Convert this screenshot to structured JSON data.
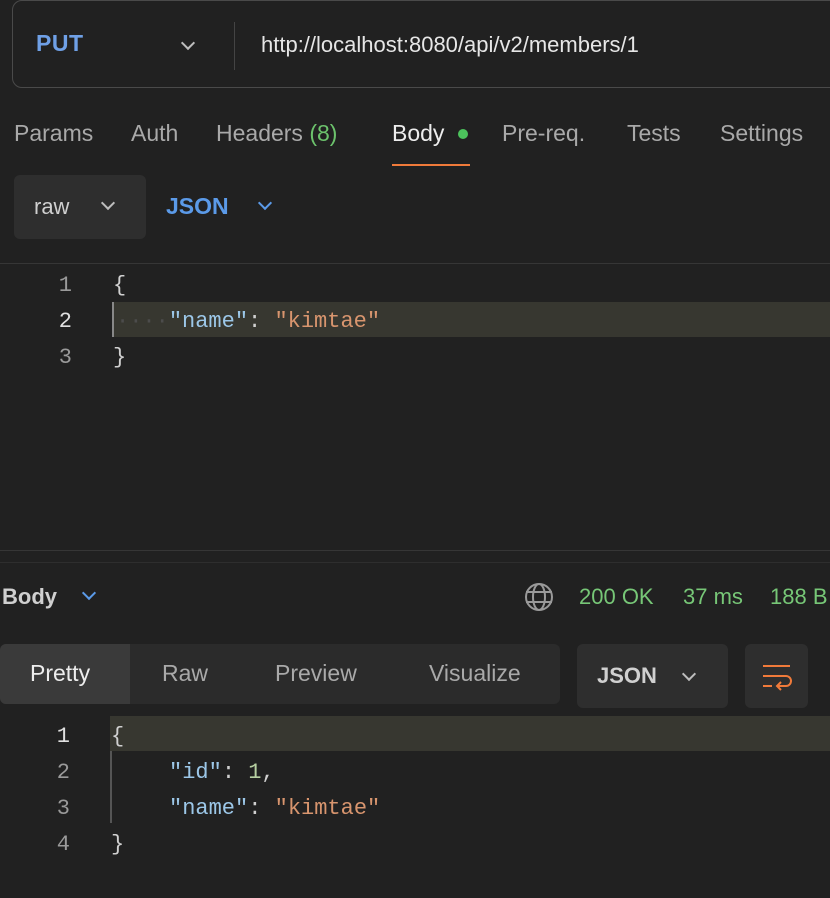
{
  "request": {
    "method": "PUT",
    "url": "http://localhost:8080/api/v2/members/1"
  },
  "tabs": [
    {
      "label": "Params"
    },
    {
      "label": "Auth"
    },
    {
      "label": "Headers",
      "count": "(8)"
    },
    {
      "label": "Body"
    },
    {
      "label": "Pre-req."
    },
    {
      "label": "Tests"
    },
    {
      "label": "Settings"
    }
  ],
  "body_mode": {
    "type": "raw",
    "format": "JSON"
  },
  "request_body": {
    "line_numbers": [
      "1",
      "2",
      "3"
    ],
    "lines": {
      "l1": "{",
      "l2_key": "\"name\"",
      "l2_colon": ": ",
      "l2_val": "\"kimtae\"",
      "l3": "}"
    }
  },
  "response": {
    "section_label": "Body",
    "status": "200 OK",
    "time": "37 ms",
    "size": "188 B",
    "views": [
      "Pretty",
      "Raw",
      "Preview",
      "Visualize"
    ],
    "format": "JSON",
    "line_numbers": [
      "1",
      "2",
      "3",
      "4"
    ],
    "lines": {
      "l1": "{",
      "l2_key": "\"id\"",
      "l2_colon": ": ",
      "l2_val": "1",
      "l2_comma": ",",
      "l3_key": "\"name\"",
      "l3_colon": ": ",
      "l3_val": "\"kimtae\"",
      "l4": "}"
    }
  },
  "colors": {
    "accent_orange": "#f07a3a",
    "accent_blue": "#5b9ae8",
    "status_green": "#77c777"
  }
}
